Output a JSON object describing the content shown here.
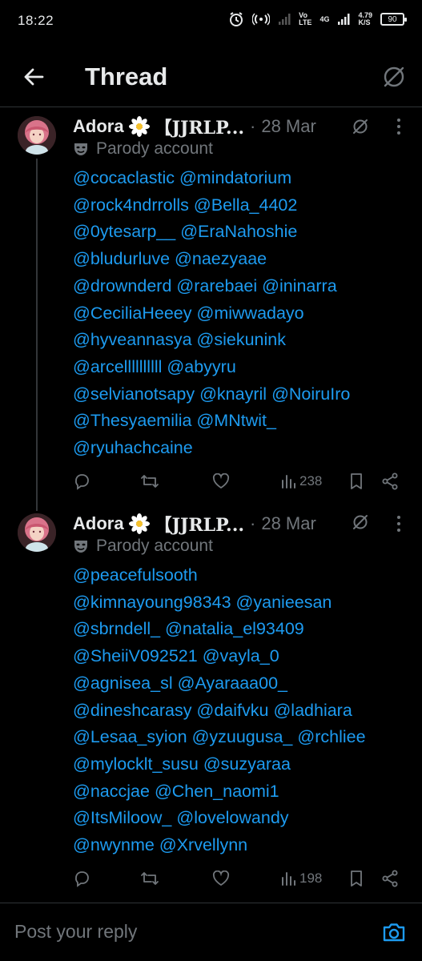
{
  "status_bar": {
    "time": "18:22",
    "net_top": "Vo",
    "net_bottom": "LTE",
    "net_type": "4G",
    "speed_top": "4.79",
    "speed_bottom": "K/S",
    "battery": "90"
  },
  "header": {
    "title": "Thread",
    "back_icon": "arrow-left-icon",
    "grok_icon": "grok-icon"
  },
  "posts": [
    {
      "author": "Adora",
      "tag": "【JJRLP...",
      "date": "28 Mar",
      "parody_label": "Parody account",
      "mentions": [
        "@cocaclastic",
        "@mindatorium",
        "@rock4ndrrolls",
        "@Bella_4402",
        "@0ytesarp__",
        "@EraNahoshie",
        "@bludurluve",
        "@naezyaae",
        "@drownderd",
        "@rarebaei",
        "@ininarra",
        "@CeciliaHeeey",
        "@miwwadayo",
        "@hyveannasya",
        "@siekunink",
        "@arcellllllllll",
        "@abyyru",
        "@selvianotsapy",
        "@knayril",
        "@NoiruIro",
        "@Thesyaemilia",
        "@MNtwit_",
        "@ryuhachcaine"
      ],
      "views": "238"
    },
    {
      "author": "Adora",
      "tag": "【JJRLP...",
      "date": "28 Mar",
      "parody_label": "Parody account",
      "mentions": [
        "@peacefulsooth",
        "@kimnayoung98343",
        "@yanieesan",
        "@sbrndell_",
        "@natalia_el93409",
        "@SheiiV092521",
        "@vayla_0",
        "@agnisea_sl",
        "@Ayaraaa00_",
        "@dineshcarasy",
        "@daifvku",
        "@ladhiara",
        "@Lesaa_syion",
        "@yzuugusa_",
        "@rchliee",
        "@mylocklt_susu",
        "@suzyaraa",
        "@naccjae",
        "@Chen_naomi1",
        "@ItsMiloow_",
        "@lovelowandy",
        "@nwynme",
        "@Xrvellynn"
      ],
      "views": "198"
    }
  ],
  "reply": {
    "placeholder": "Post your reply"
  },
  "colors": {
    "background": "#000000",
    "mention": "#1d9bf0",
    "secondary_text": "#71767b",
    "divider": "#2f3336"
  }
}
